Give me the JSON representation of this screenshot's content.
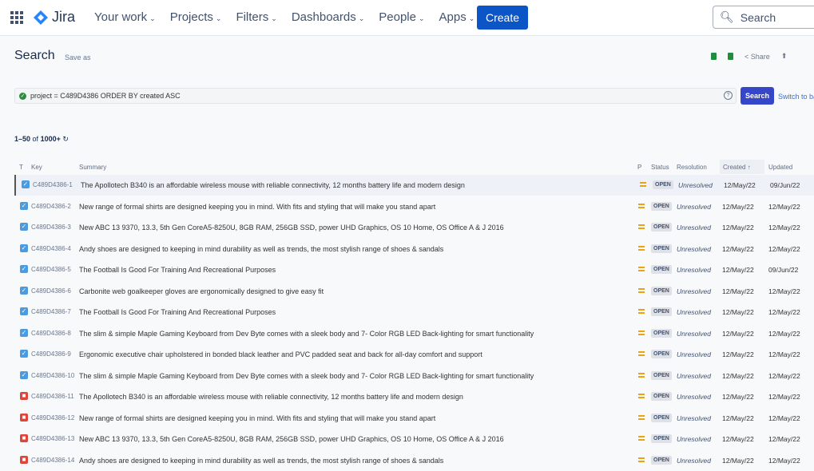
{
  "header": {
    "logo": "Jira",
    "nav": [
      "Your work",
      "Projects",
      "Filters",
      "Dashboards",
      "People",
      "Apps"
    ],
    "create": "Create",
    "search_placeholder": "Search"
  },
  "page": {
    "title": "Search",
    "save_as": "Save as",
    "share": "Share"
  },
  "jql": {
    "query": "project = C489D4386 ORDER BY created ASC",
    "search_button": "Search",
    "switch": "Switch to basic"
  },
  "results": {
    "range": "1–50",
    "of": "of",
    "total": "1000+"
  },
  "columns": {
    "type": "T",
    "key": "Key",
    "summary": "Summary",
    "priority": "P",
    "status": "Status",
    "resolution": "Resolution",
    "created": "Created",
    "updated": "Updated"
  },
  "colors": {
    "accent": "#0b55c6",
    "task": "#4a9be0",
    "bug": "#e0453a",
    "priority": "#e8a317"
  },
  "rows": [
    {
      "type": "task",
      "key": "C489D4386-1",
      "summary": "The Apollotech B340 is an affordable wireless mouse with reliable connectivity, 12 months battery life and modern design",
      "status": "OPEN",
      "resolution": "Unresolved",
      "created": "12/May/22",
      "updated": "09/Jun/22"
    },
    {
      "type": "task",
      "key": "C489D4386-2",
      "summary": "New range of formal shirts are designed keeping you in mind. With fits and styling that will make you stand apart",
      "status": "OPEN",
      "resolution": "Unresolved",
      "created": "12/May/22",
      "updated": "12/May/22"
    },
    {
      "type": "task",
      "key": "C489D4386-3",
      "summary": "New ABC 13 9370, 13.3, 5th Gen CoreA5-8250U, 8GB RAM, 256GB SSD, power UHD Graphics, OS 10 Home, OS Office A & J 2016",
      "status": "OPEN",
      "resolution": "Unresolved",
      "created": "12/May/22",
      "updated": "12/May/22"
    },
    {
      "type": "task",
      "key": "C489D4386-4",
      "summary": "Andy shoes are designed to keeping in mind durability as well as trends, the most stylish range of shoes & sandals",
      "status": "OPEN",
      "resolution": "Unresolved",
      "created": "12/May/22",
      "updated": "12/May/22"
    },
    {
      "type": "task",
      "key": "C489D4386-5",
      "summary": "The Football Is Good For Training And Recreational Purposes",
      "status": "OPEN",
      "resolution": "Unresolved",
      "created": "12/May/22",
      "updated": "09/Jun/22"
    },
    {
      "type": "task",
      "key": "C489D4386-6",
      "summary": "Carbonite web goalkeeper gloves are ergonomically designed to give easy fit",
      "status": "OPEN",
      "resolution": "Unresolved",
      "created": "12/May/22",
      "updated": "12/May/22"
    },
    {
      "type": "task",
      "key": "C489D4386-7",
      "summary": "The Football Is Good For Training And Recreational Purposes",
      "status": "OPEN",
      "resolution": "Unresolved",
      "created": "12/May/22",
      "updated": "12/May/22"
    },
    {
      "type": "task",
      "key": "C489D4386-8",
      "summary": "The slim & simple Maple Gaming Keyboard from Dev Byte comes with a sleek body and 7- Color RGB LED Back-lighting for smart functionality",
      "status": "OPEN",
      "resolution": "Unresolved",
      "created": "12/May/22",
      "updated": "12/May/22"
    },
    {
      "type": "task",
      "key": "C489D4386-9",
      "summary": "Ergonomic executive chair upholstered in bonded black leather and PVC padded seat and back for all-day comfort and support",
      "status": "OPEN",
      "resolution": "Unresolved",
      "created": "12/May/22",
      "updated": "12/May/22"
    },
    {
      "type": "task",
      "key": "C489D4386-10",
      "summary": "The slim & simple Maple Gaming Keyboard from Dev Byte comes with a sleek body and 7- Color RGB LED Back-lighting for smart functionality",
      "status": "OPEN",
      "resolution": "Unresolved",
      "created": "12/May/22",
      "updated": "12/May/22"
    },
    {
      "type": "bug",
      "key": "C489D4386-11",
      "summary": "The Apollotech B340 is an affordable wireless mouse with reliable connectivity, 12 months battery life and modern design",
      "status": "OPEN",
      "resolution": "Unresolved",
      "created": "12/May/22",
      "updated": "12/May/22"
    },
    {
      "type": "bug",
      "key": "C489D4386-12",
      "summary": "New range of formal shirts are designed keeping you in mind. With fits and styling that will make you stand apart",
      "status": "OPEN",
      "resolution": "Unresolved",
      "created": "12/May/22",
      "updated": "12/May/22"
    },
    {
      "type": "bug",
      "key": "C489D4386-13",
      "summary": "New ABC 13 9370, 13.3, 5th Gen CoreA5-8250U, 8GB RAM, 256GB SSD, power UHD Graphics, OS 10 Home, OS Office A & J 2016",
      "status": "OPEN",
      "resolution": "Unresolved",
      "created": "12/May/22",
      "updated": "12/May/22"
    },
    {
      "type": "bug",
      "key": "C489D4386-14",
      "summary": "Andy shoes are designed to keeping in mind durability as well as trends, the most stylish range of shoes & sandals",
      "status": "OPEN",
      "resolution": "Unresolved",
      "created": "12/May/22",
      "updated": "12/May/22"
    }
  ]
}
